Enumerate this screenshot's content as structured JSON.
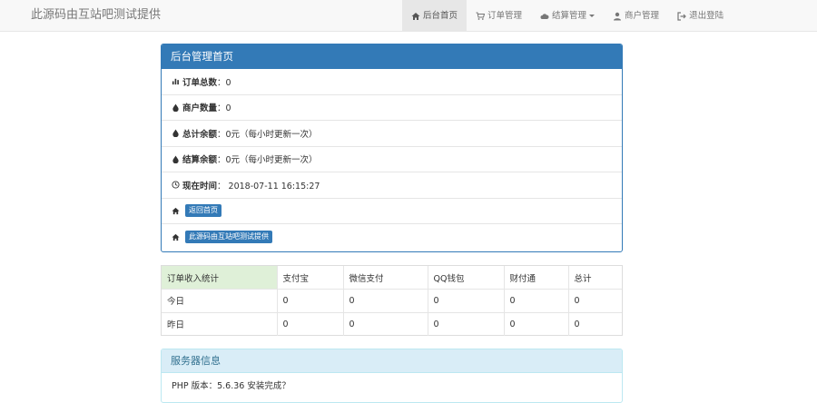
{
  "brand": "此源码由互站吧测试提供",
  "nav": [
    {
      "label": "后台首页",
      "icon": "home-icon",
      "active": true
    },
    {
      "label": "订单管理",
      "icon": "shopping-cart-icon"
    },
    {
      "label": "结算管理",
      "icon": "cloud-icon",
      "dropdown": true
    },
    {
      "label": "商户管理",
      "icon": "user-icon"
    },
    {
      "label": "退出登陆",
      "icon": "logout-icon"
    }
  ],
  "main_panel": {
    "title": "后台管理首页",
    "rows": [
      {
        "icon": "stats-icon",
        "label": "订单总数",
        "value": "：0"
      },
      {
        "icon": "tint-icon",
        "label": "商户数量",
        "value": "：0"
      },
      {
        "icon": "tint-icon",
        "label": "总计余额",
        "value": "：0元（每小时更新一次）"
      },
      {
        "icon": "tint-icon",
        "label": "结算余额",
        "value": "：0元（每小时更新一次）"
      },
      {
        "icon": "clock-icon",
        "label": "现在时间",
        "value": "： 2018-07-11 16:15:27"
      }
    ],
    "btn_home": "返回首页",
    "btn_source": "此源码由互站吧测试提供"
  },
  "stats_table": {
    "headers": [
      "订单收入统计",
      "支付宝",
      "微信支付",
      "QQ钱包",
      "财付通",
      "总计"
    ],
    "rows": [
      [
        "今日",
        "0",
        "0",
        "0",
        "0",
        "0"
      ],
      [
        "昨日",
        "0",
        "0",
        "0",
        "0",
        "0"
      ]
    ]
  },
  "server_panel": {
    "title": "服务器信息",
    "first_row": "PHP 版本：5.6.36 安装完成？"
  }
}
